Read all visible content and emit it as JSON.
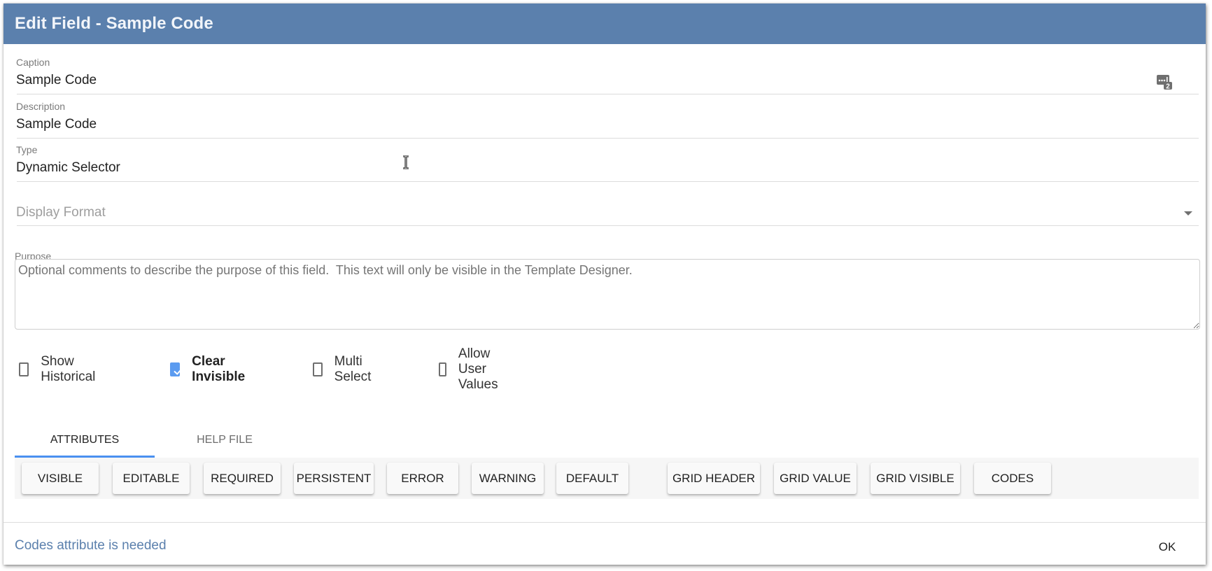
{
  "dialog": {
    "title": "Edit Field - Sample Code",
    "header_color": "#5b80ad"
  },
  "fields": {
    "caption": {
      "label": "Caption",
      "value": "Sample Code",
      "icon": "localize-text-icon"
    },
    "description": {
      "label": "Description",
      "value": "Sample Code"
    },
    "type": {
      "label": "Type",
      "value": "Dynamic Selector"
    },
    "display_format": {
      "placeholder": "Display Format",
      "value": "",
      "icon": "dropdown-arrow-icon"
    },
    "purpose": {
      "label": "Purpose",
      "placeholder": "Optional comments to describe the purpose of this field.  This text will only be visible in the Template Designer.",
      "value": ""
    }
  },
  "checkboxes": [
    {
      "label": "Show Historical",
      "checked": false
    },
    {
      "label": "Clear Invisible",
      "checked": true
    },
    {
      "label": "Multi Select",
      "checked": false
    },
    {
      "label": "Allow User Values",
      "checked": false
    }
  ],
  "tabs": [
    {
      "label": "ATTRIBUTES",
      "active": true
    },
    {
      "label": "HELP FILE",
      "active": false
    }
  ],
  "attribute_buttons": [
    "VISIBLE",
    "EDITABLE",
    "REQUIRED",
    "PERSISTENT",
    "ERROR",
    "WARNING",
    "DEFAULT",
    "GRID HEADER",
    "GRID VALUE",
    "GRID VISIBLE",
    "CODES"
  ],
  "footer": {
    "status": "Codes attribute is needed",
    "status_color": "#5b80ad",
    "ok_label": "OK"
  },
  "accent_color": "#4a90f0"
}
